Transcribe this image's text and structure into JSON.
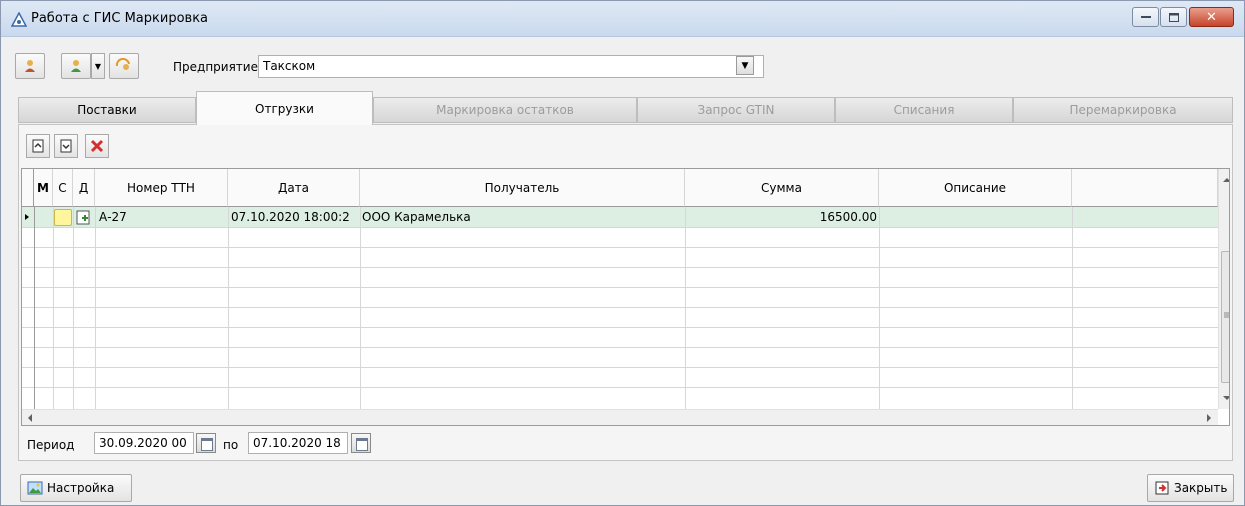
{
  "window": {
    "title": "Работа с ГИС Маркировка",
    "min_label": "–",
    "max_label": "□",
    "close_label": "✕"
  },
  "toolbar": {
    "enterprise_label": "Предприятие",
    "enterprise_value": "Такском",
    "dropdown_arrow": "▼"
  },
  "tabs": [
    {
      "label": "Поставки",
      "state": "normal"
    },
    {
      "label": "Отгрузки",
      "state": "active"
    },
    {
      "label": "Маркировка остатков",
      "state": "disabled"
    },
    {
      "label": "Запрос GTIN",
      "state": "disabled"
    },
    {
      "label": "Списания",
      "state": "disabled"
    },
    {
      "label": "Перемаркировка",
      "state": "disabled"
    }
  ],
  "grid": {
    "columns": [
      "М",
      "С",
      "Д",
      "Номер ТТН",
      "Дата",
      "Получатель",
      "Сумма",
      "Описание"
    ],
    "rows": [
      {
        "m": "",
        "c": "",
        "d": "",
        "ttn": "А-27",
        "date": "07.10.2020 18:00:2",
        "receiver": "ООО Карамелька",
        "sum": "16500.00",
        "desc": ""
      }
    ]
  },
  "period": {
    "label": "Период",
    "from": "30.09.2020 00",
    "to_label": "по",
    "to": "07.10.2020 18"
  },
  "footer": {
    "settings_label": "Настройка",
    "close_label": "Закрыть"
  },
  "colors": {
    "selected_row": "#dcefe2",
    "delete_red": "#d32f2f",
    "status_yellow": "#fff59d"
  }
}
